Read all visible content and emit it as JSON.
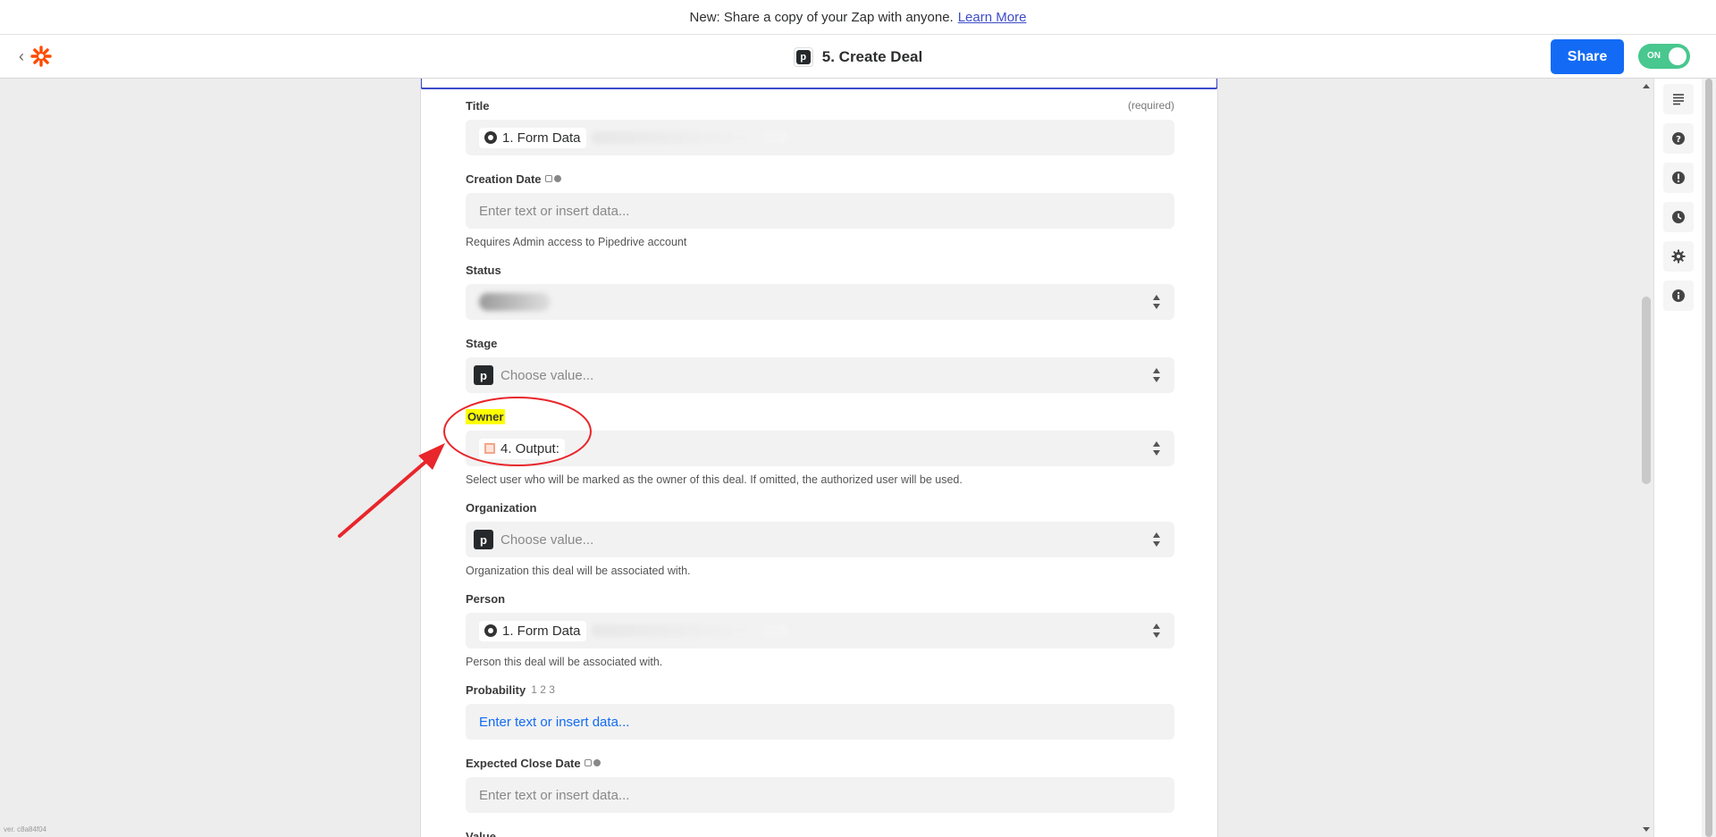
{
  "banner": {
    "text": "New: Share a copy of your Zap with anyone.",
    "link": "Learn More"
  },
  "header": {
    "step_title": "5. Create Deal",
    "share_label": "Share",
    "toggle_label": "ON"
  },
  "colors": {
    "accent": "#136bf5",
    "brand": "#ff4a00",
    "toggle_on": "#48c78e",
    "annotation": "#e8262b",
    "highlight": "#ffff00"
  },
  "fields": {
    "title": {
      "label": "Title",
      "required": "(required)",
      "pill": "1. Form Data"
    },
    "creation_date": {
      "label": "Creation Date",
      "placeholder": "Enter text or insert data...",
      "help": "Requires Admin access to Pipedrive account"
    },
    "status": {
      "label": "Status"
    },
    "stage": {
      "label": "Stage",
      "placeholder": "Choose value..."
    },
    "owner": {
      "label": "Owner",
      "pill": "4. Output:",
      "help": "Select user who will be marked as the owner of this deal. If omitted, the authorized user will be used."
    },
    "organization": {
      "label": "Organization",
      "placeholder": "Choose value...",
      "help": "Organization this deal will be associated with."
    },
    "person": {
      "label": "Person",
      "pill": "1. Form Data",
      "help": "Person this deal will be associated with."
    },
    "probability": {
      "label": "Probability",
      "hint": "1 2 3",
      "placeholder": "Enter text or insert data..."
    },
    "expected_close_date": {
      "label": "Expected Close Date",
      "placeholder": "Enter text or insert data..."
    },
    "value": {
      "label": "Value"
    }
  },
  "side_icons": [
    "notes-icon",
    "help-icon",
    "alert-icon",
    "history-icon",
    "settings-icon",
    "info-icon"
  ],
  "version": "ver. c8a84f04"
}
